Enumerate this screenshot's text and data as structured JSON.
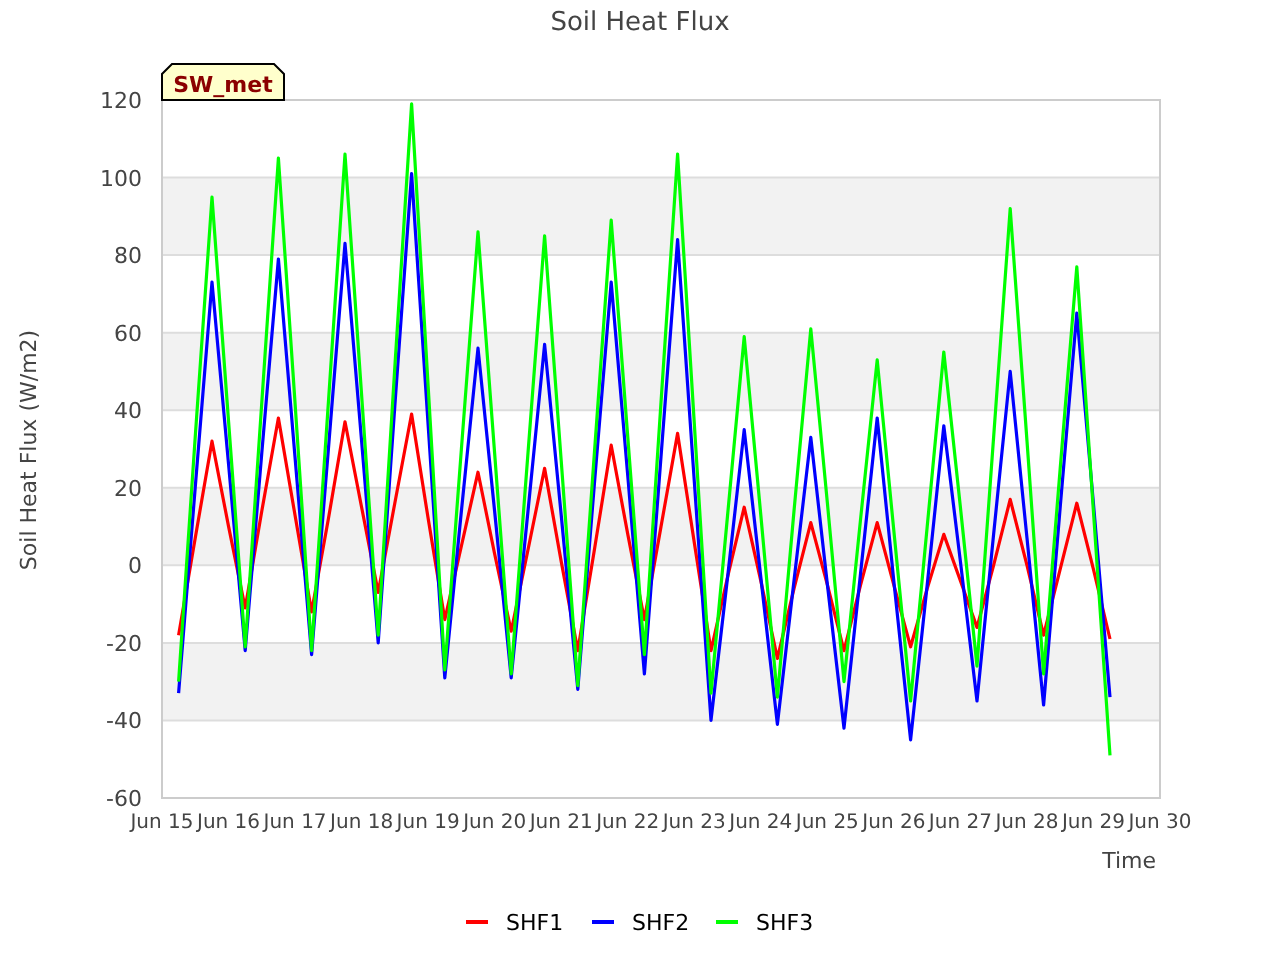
{
  "badge": "SW_met",
  "chart_data": {
    "type": "line",
    "title": "Soil Heat Flux",
    "xlabel": "Time",
    "ylabel": "Soil Heat Flux (W/m2)",
    "categories": [
      "Jun 15",
      null,
      null,
      null,
      "Jun 16",
      null,
      null,
      null,
      "Jun 17",
      null,
      null,
      null,
      "Jun 18",
      null,
      null,
      null,
      "Jun 19",
      null,
      null,
      null,
      "Jun 20",
      null,
      null,
      null,
      "Jun 21",
      null,
      null,
      null,
      "Jun 22",
      null,
      null,
      null,
      "Jun 23",
      null,
      null,
      null,
      "Jun 24",
      null,
      null,
      null,
      "Jun 25",
      null,
      null,
      null,
      "Jun 26",
      null,
      null,
      null,
      "Jun 27",
      null,
      null,
      null,
      "Jun 28",
      null,
      null,
      null,
      "Jun 29",
      null,
      null,
      null,
      "Jun 30"
    ],
    "series": [
      {
        "name": "SHF1",
        "color": "#ff0000",
        "values": [
          null,
          -18,
          7,
          32,
          10,
          -11,
          14,
          38,
          13,
          -12,
          12,
          37,
          15,
          -7,
          16,
          39,
          12,
          -14,
          5,
          24,
          3,
          -17,
          4,
          25,
          1,
          -22,
          4,
          31,
          8,
          -14,
          10,
          34,
          6,
          -22,
          -3,
          15,
          -4,
          -24,
          -6,
          11,
          -5,
          -22,
          -5,
          11,
          -5,
          -21,
          -6,
          8,
          -4,
          -16,
          0,
          17,
          0,
          -18,
          -1,
          16,
          -1,
          -19,
          null,
          null,
          null
        ]
      },
      {
        "name": "SHF2",
        "color": "#0000ff",
        "values": [
          null,
          -33,
          20,
          73,
          26,
          -22,
          29,
          79,
          28,
          -23,
          30,
          83,
          32,
          -20,
          41,
          101,
          36,
          -29,
          14,
          56,
          14,
          -29,
          14,
          57,
          13,
          -32,
          21,
          73,
          23,
          -28,
          28,
          84,
          22,
          -40,
          -3,
          35,
          -3,
          -41,
          -4,
          33,
          -5,
          -42,
          -2,
          38,
          -4,
          -45,
          -5,
          36,
          1,
          -35,
          8,
          50,
          7,
          -36,
          15,
          65,
          16,
          -34,
          null,
          null,
          null
        ]
      },
      {
        "name": "SHF3",
        "color": "#00ff00",
        "values": [
          null,
          -30,
          33,
          95,
          37,
          -21,
          42,
          105,
          42,
          -22,
          42,
          106,
          44,
          -18,
          51,
          119,
          46,
          -27,
          30,
          86,
          29,
          -28,
          29,
          85,
          27,
          -31,
          29,
          89,
          33,
          -23,
          42,
          106,
          37,
          -33,
          13,
          59,
          13,
          -34,
          14,
          61,
          16,
          -30,
          12,
          53,
          9,
          -35,
          10,
          55,
          15,
          -26,
          33,
          92,
          32,
          -28,
          25,
          77,
          14,
          -49,
          null,
          null,
          null
        ]
      }
    ],
    "grid": true,
    "legend": "bottom",
    "ylim": [
      -60,
      120
    ],
    "yticks": [
      -60,
      -40,
      -20,
      0,
      20,
      40,
      60,
      80,
      100,
      120
    ]
  }
}
